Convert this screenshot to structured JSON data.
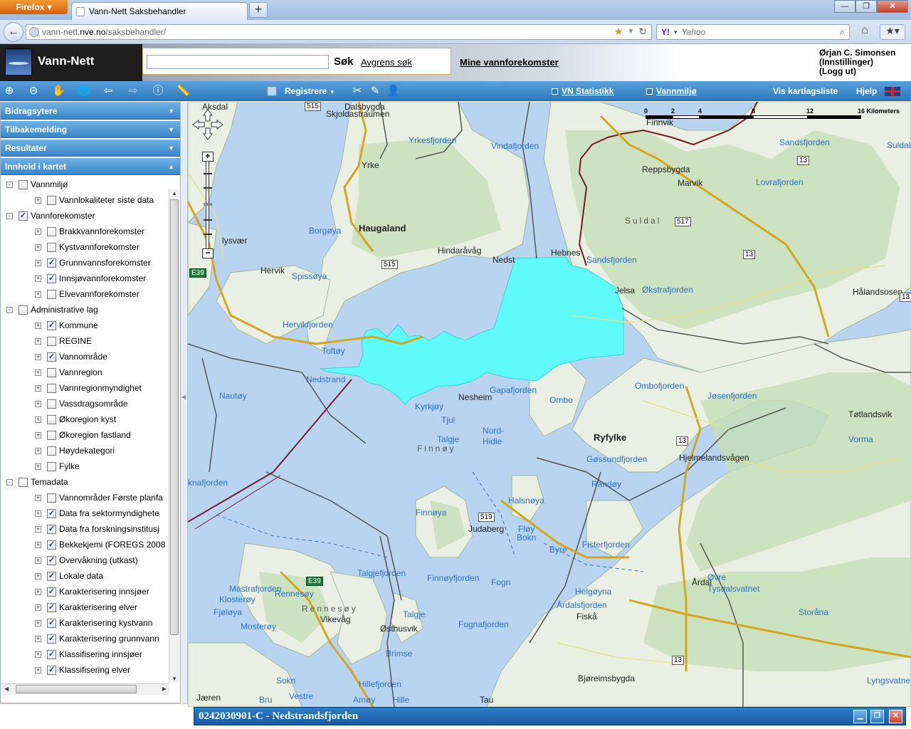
{
  "browser": {
    "app_button": "Firefox",
    "tab_title": "Vann-Nett Saksbehandler",
    "new_tab": "+",
    "url_prefix": "vann-nett.",
    "url_host": "nve.no",
    "url_path": "/saksbehandler/",
    "search_engine": "Y!",
    "search_placeholder": "Yahoo"
  },
  "app": {
    "name": "Vann-Nett",
    "search_button": "Søk",
    "refine_link": "Avgrens søk",
    "my_waters_link": "Mine vannforekomster",
    "user_name": "Ørjan C. Simonsen",
    "settings_link": "(Innstillinger)",
    "logout_link": "(Logg ut)"
  },
  "toolbar": {
    "registrere": "Registrere",
    "vn_statistikk": "VN Statistikk",
    "vannmiljo": "Vannmiljø",
    "kartlagsliste": "Vis kartlagsliste",
    "hjelp": "Hjelp"
  },
  "sidebar": {
    "panels": [
      "Bidragsytere",
      "Tilbakemelding",
      "Resultater",
      "Innhold i kartet"
    ],
    "tree": [
      {
        "label": "Vannmiljø",
        "level": 0,
        "checked": false,
        "expander": "-"
      },
      {
        "label": "Vannlokaliteter siste data",
        "level": 1,
        "checked": false,
        "expander": "+"
      },
      {
        "label": "Vannforekomster",
        "level": 0,
        "checked": true,
        "expander": "-"
      },
      {
        "label": "Brakkvannforekomster",
        "level": 1,
        "checked": false,
        "expander": "+"
      },
      {
        "label": "Kystvannforekomster",
        "level": 1,
        "checked": false,
        "expander": "+"
      },
      {
        "label": "Grunnvannsforekomster",
        "level": 1,
        "checked": true,
        "expander": "+"
      },
      {
        "label": "Innsjøvannforekomster",
        "level": 1,
        "checked": true,
        "expander": "+"
      },
      {
        "label": "Elvevannforekomster",
        "level": 1,
        "checked": false,
        "expander": "+"
      },
      {
        "label": "Administrative lag",
        "level": 0,
        "checked": false,
        "expander": "-"
      },
      {
        "label": "Kommune",
        "level": 1,
        "checked": true,
        "expander": "+"
      },
      {
        "label": "REGINE",
        "level": 1,
        "checked": false,
        "expander": "+"
      },
      {
        "label": "Vannområde",
        "level": 1,
        "checked": true,
        "expander": "+"
      },
      {
        "label": "Vannregion",
        "level": 1,
        "checked": false,
        "expander": "+"
      },
      {
        "label": "Vannregionmyndighet",
        "level": 1,
        "checked": false,
        "expander": "+"
      },
      {
        "label": "Vassdragsområde",
        "level": 1,
        "checked": false,
        "expander": "+"
      },
      {
        "label": "Økoregion kyst",
        "level": 1,
        "checked": false,
        "expander": "+"
      },
      {
        "label": "Økoregion fastland",
        "level": 1,
        "checked": false,
        "expander": "+"
      },
      {
        "label": "Høydekategori",
        "level": 1,
        "checked": false,
        "expander": "+"
      },
      {
        "label": "Fylke",
        "level": 1,
        "checked": false,
        "expander": "+"
      },
      {
        "label": "Temadata",
        "level": 0,
        "checked": false,
        "expander": "-"
      },
      {
        "label": "Vannområder Første planfa",
        "level": 1,
        "checked": false,
        "expander": "+"
      },
      {
        "label": "Data fra sektormyndighete",
        "level": 1,
        "checked": true,
        "expander": "+"
      },
      {
        "label": "Data fra forskningsinstitusj",
        "level": 1,
        "checked": true,
        "expander": "+"
      },
      {
        "label": "Bekkekjemi (FOREGS 2008",
        "level": 1,
        "checked": true,
        "expander": "+"
      },
      {
        "label": "Overvåkning (utkast)",
        "level": 1,
        "checked": true,
        "expander": "+"
      },
      {
        "label": "Lokale data",
        "level": 1,
        "checked": true,
        "expander": "+"
      },
      {
        "label": "Karakterisering innsjøer",
        "level": 1,
        "checked": true,
        "expander": "+"
      },
      {
        "label": "Karakterisering elver",
        "level": 1,
        "checked": true,
        "expander": "+"
      },
      {
        "label": "Karakterisering kystvann",
        "level": 1,
        "checked": true,
        "expander": "+"
      },
      {
        "label": "Karakterisering grunnvann",
        "level": 1,
        "checked": true,
        "expander": "+"
      },
      {
        "label": "Klassifisering innsjøer",
        "level": 1,
        "checked": true,
        "expander": "+"
      },
      {
        "label": "Klassifisering elver",
        "level": 1,
        "checked": true,
        "expander": "+"
      }
    ]
  },
  "map": {
    "scale": [
      "0",
      "2",
      "4",
      "8",
      "12",
      "16 Kilometers"
    ],
    "selected_waterbody": "0242030901-C - Nedstrandsfjorden",
    "labels": [
      {
        "text": "Aksdal",
        "kind": "land"
      },
      {
        "text": "Dalsbygda",
        "kind": "land"
      },
      {
        "text": "Skjoldastraumen",
        "kind": "land"
      },
      {
        "text": "Yrkesfjorden",
        "kind": "water"
      },
      {
        "text": "Vindafjorden",
        "kind": "water"
      },
      {
        "text": "Finnvik",
        "kind": "land"
      },
      {
        "text": "Sandsfjorden",
        "kind": "water"
      },
      {
        "text": "Suldalsl",
        "kind": "water"
      },
      {
        "text": "Yrke",
        "kind": "land"
      },
      {
        "text": "Reppsbygda",
        "kind": "land"
      },
      {
        "text": "Marvik",
        "kind": "land"
      },
      {
        "text": "Lovrafjorden",
        "kind": "water"
      },
      {
        "text": "Borgøya",
        "kind": "water"
      },
      {
        "text": "Haugaland",
        "kind": "land-bold"
      },
      {
        "text": "Suldal",
        "kind": "region"
      },
      {
        "text": "lysvær",
        "kind": "land"
      },
      {
        "text": "Hindaråvåg",
        "kind": "land"
      },
      {
        "text": "Nedst",
        "kind": "land"
      },
      {
        "text": "Hebnes",
        "kind": "land"
      },
      {
        "text": "Sandsfjorden",
        "kind": "water"
      },
      {
        "text": "Hervik",
        "kind": "land"
      },
      {
        "text": "Spissøya",
        "kind": "water"
      },
      {
        "text": "Jelsa",
        "kind": "land"
      },
      {
        "text": "Økstrafjorden",
        "kind": "water"
      },
      {
        "text": "Hålandsosen",
        "kind": "land"
      },
      {
        "text": "Hervikfjorden",
        "kind": "water"
      },
      {
        "text": "Toftøy",
        "kind": "water"
      },
      {
        "text": "Nedstrand",
        "kind": "water"
      },
      {
        "text": "Nesheim",
        "kind": "land"
      },
      {
        "text": "Gapafjorden",
        "kind": "water"
      },
      {
        "text": "Ombofjorden",
        "kind": "water"
      },
      {
        "text": "Jøsenfjorden",
        "kind": "water"
      },
      {
        "text": "Nautøy",
        "kind": "water"
      },
      {
        "text": "Kyrkjøy",
        "kind": "water"
      },
      {
        "text": "Ombo",
        "kind": "water"
      },
      {
        "text": "Tjul",
        "kind": "water"
      },
      {
        "text": "Tøtlandsvik",
        "kind": "land"
      },
      {
        "text": "Talgje",
        "kind": "water"
      },
      {
        "text": "Nord-",
        "kind": "water"
      },
      {
        "text": "Hidle",
        "kind": "water"
      },
      {
        "text": "Ryfylke",
        "kind": "land-bold"
      },
      {
        "text": "Vorma",
        "kind": "water"
      },
      {
        "text": "Finnøy",
        "kind": "region"
      },
      {
        "text": "Gøssundfjorden",
        "kind": "water"
      },
      {
        "text": "Hjelmelandsvågen",
        "kind": "land"
      },
      {
        "text": "knafjorden",
        "kind": "water"
      },
      {
        "text": "Randøy",
        "kind": "water"
      },
      {
        "text": "Finnøya",
        "kind": "water"
      },
      {
        "text": "Halsnøya",
        "kind": "water"
      },
      {
        "text": "Judaberg",
        "kind": "land"
      },
      {
        "text": "Fløy",
        "kind": "water"
      },
      {
        "text": "Bokn",
        "kind": "water"
      },
      {
        "text": "Fisterfjorden",
        "kind": "water"
      },
      {
        "text": "Byre",
        "kind": "water"
      },
      {
        "text": "Talgjefjorden",
        "kind": "water"
      },
      {
        "text": "Finnøyfjorden",
        "kind": "water"
      },
      {
        "text": "Fogn",
        "kind": "water"
      },
      {
        "text": "Årdal",
        "kind": "land"
      },
      {
        "text": "Øvre",
        "kind": "water"
      },
      {
        "text": "Tysdalsvatnet",
        "kind": "water"
      },
      {
        "text": "Mastrafjorden",
        "kind": "water"
      },
      {
        "text": "Rennesøy",
        "kind": "water"
      },
      {
        "text": "Helgøyna",
        "kind": "water"
      },
      {
        "text": "Klosterøy",
        "kind": "water"
      },
      {
        "text": "Årdalsfjorden",
        "kind": "water"
      },
      {
        "text": "Storåna",
        "kind": "water"
      },
      {
        "text": "Fjøløya",
        "kind": "water"
      },
      {
        "text": "Rennesøy",
        "kind": "region"
      },
      {
        "text": "Talgje",
        "kind": "water"
      },
      {
        "text": "Fiskå",
        "kind": "land"
      },
      {
        "text": "Vikevåg",
        "kind": "land"
      },
      {
        "text": "Mosterøy",
        "kind": "water"
      },
      {
        "text": "Østhusvik",
        "kind": "land"
      },
      {
        "text": "Fognafjorden",
        "kind": "water"
      },
      {
        "text": "Brimse",
        "kind": "water"
      },
      {
        "text": "Bjøreimsbygda",
        "kind": "land"
      },
      {
        "text": "Lyngsvatne",
        "kind": "water"
      },
      {
        "text": "Sokn",
        "kind": "water"
      },
      {
        "text": "Hillefjorden",
        "kind": "water"
      },
      {
        "text": "Jæren",
        "kind": "land"
      },
      {
        "text": "Vestre",
        "kind": "water"
      },
      {
        "text": "Bru",
        "kind": "water"
      },
      {
        "text": "Amøy",
        "kind": "water"
      },
      {
        "text": "Hille",
        "kind": "water"
      },
      {
        "text": "Tau",
        "kind": "land"
      }
    ],
    "road_signs": [
      "515",
      "515",
      "517",
      "13",
      "13",
      "13",
      "13",
      "519",
      "13",
      "E39",
      "E39"
    ]
  }
}
